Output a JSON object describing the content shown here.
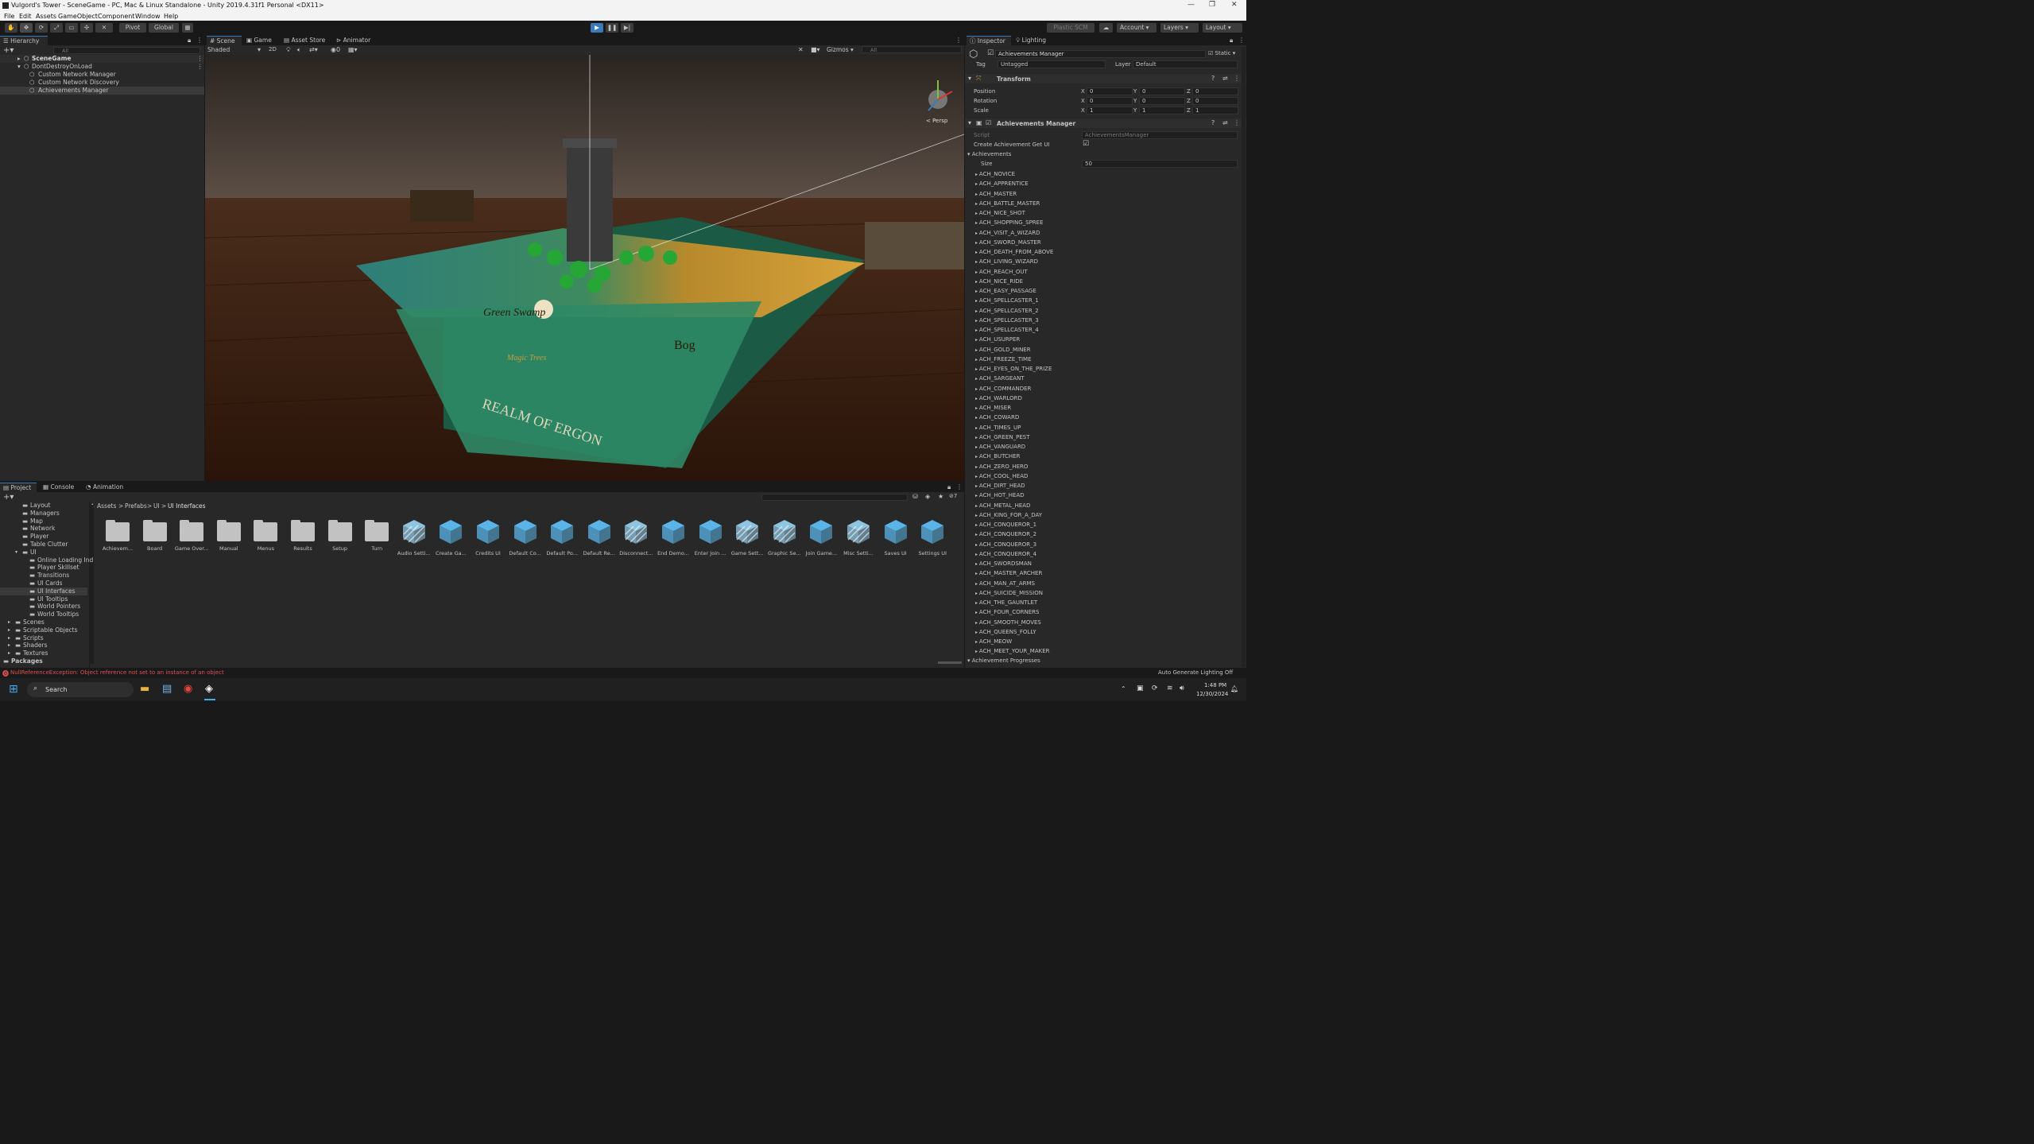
{
  "window": {
    "title": "Vulgord's Tower - SceneGame - PC, Mac & Linux Standalone - Unity 2019.4.31f1 Personal <DX11>"
  },
  "menu": [
    "File",
    "Edit",
    "Assets",
    "GameObject",
    "Component",
    "Window",
    "Help"
  ],
  "toolbar": {
    "pivot": "Pivot",
    "global": "Global",
    "plastic": "Plastic SCM",
    "account": "Account",
    "layers": "Layers",
    "layout": "Layout"
  },
  "hierarchy": {
    "tab": "Hierarchy",
    "search_placeholder": "All",
    "items": [
      {
        "label": "SceneGame"
      },
      {
        "label": "DontDestroyOnLoad"
      },
      {
        "label": "Custom Network Manager"
      },
      {
        "label": "Custom Network Discovery"
      },
      {
        "label": "Achievements Manager"
      }
    ]
  },
  "scene": {
    "tabs": [
      "Scene",
      "Game",
      "Asset Store",
      "Animator"
    ],
    "shading": "Shaded",
    "mode_2d": "2D",
    "gizmos": "Gizmos",
    "search_placeholder": "All",
    "persp": "< Persp",
    "board_labels": [
      "Green Swamp",
      "Magic Trees",
      "Bog",
      "REALM OF ERGON"
    ]
  },
  "inspector": {
    "tabs": [
      "Inspector",
      "Lighting"
    ],
    "object_name": "Achievements Manager",
    "static_label": "Static",
    "tag_label": "Tag",
    "tag_value": "Untagged",
    "layer_label": "Layer",
    "layer_value": "Default",
    "transform": {
      "title": "Transform",
      "rows": [
        {
          "label": "Position",
          "x": "0",
          "y": "0",
          "z": "0"
        },
        {
          "label": "Rotation",
          "x": "0",
          "y": "0",
          "z": "0"
        },
        {
          "label": "Scale",
          "x": "1",
          "y": "1",
          "z": "1"
        }
      ]
    },
    "component": {
      "title": "Achievements Manager",
      "script_label": "Script",
      "script_value": "AchievementsManager",
      "create_label": "Create Achievement Get UI",
      "achievements_label": "Achievements",
      "size_label": "Size",
      "size_value": "50",
      "progress_label": "Achievement Progresses"
    },
    "achievements": [
      "ACH_NOVICE",
      "ACH_APPRENTICE",
      "ACH_MASTER",
      "ACH_BATTLE_MASTER",
      "ACH_NICE_SHOT",
      "ACH_SHOPPING_SPREE",
      "ACH_VISIT_A_WIZARD",
      "ACH_SWORD_MASTER",
      "ACH_DEATH_FROM_ABOVE",
      "ACH_LIVING_WIZARD",
      "ACH_REACH_OUT",
      "ACH_NICE_RIDE",
      "ACH_EASY_PASSAGE",
      "ACH_SPELLCASTER_1",
      "ACH_SPELLCASTER_2",
      "ACH_SPELLCASTER_3",
      "ACH_SPELLCASTER_4",
      "ACH_USURPER",
      "ACH_GOLD_MINER",
      "ACH_FREEZE_TIME",
      "ACH_EYES_ON_THE_PRIZE",
      "ACH_SARGEANT",
      "ACH_COMMANDER",
      "ACH_WARLORD",
      "ACH_MISER",
      "ACH_COWARD",
      "ACH_TIMES_UP",
      "ACH_GREEN_PEST",
      "ACH_VANGUARD",
      "ACH_BUTCHER",
      "ACH_ZERO_HERO",
      "ACH_COOL_HEAD",
      "ACH_DIRT_HEAD",
      "ACH_HOT_HEAD",
      "ACH_METAL_HEAD",
      "ACH_KING_FOR_A_DAY",
      "ACH_CONQUEROR_1",
      "ACH_CONQUEROR_2",
      "ACH_CONQUEROR_3",
      "ACH_CONQUEROR_4",
      "ACH_SWORDSMAN",
      "ACH_MASTER_ARCHER",
      "ACH_MAN_AT_ARMS",
      "ACH_SUICIDE_MISSION",
      "ACH_THE_GAUNTLET",
      "ACH_FOUR_CORNERS",
      "ACH_SMOOTH_MOVES",
      "ACH_QUEENS_FOLLY",
      "ACH_MEOW",
      "ACH_MEET_YOUR_MAKER"
    ]
  },
  "project": {
    "tabs": [
      "Project",
      "Console",
      "Animation"
    ],
    "badge": "7",
    "breadcrumb": [
      "Assets",
      "Prefabs",
      "UI",
      "UI Interfaces"
    ],
    "tree": [
      {
        "label": "Layout",
        "indent": 1
      },
      {
        "label": "Managers",
        "indent": 1
      },
      {
        "label": "Map",
        "indent": 1
      },
      {
        "label": "Network",
        "indent": 1
      },
      {
        "label": "Player",
        "indent": 1
      },
      {
        "label": "Table Clutter",
        "indent": 1
      },
      {
        "label": "UI",
        "indent": 1
      },
      {
        "label": "Online Loading Ind",
        "indent": 2
      },
      {
        "label": "Player Skillset",
        "indent": 2
      },
      {
        "label": "Transitions",
        "indent": 2
      },
      {
        "label": "UI Cards",
        "indent": 2
      },
      {
        "label": "UI Interfaces",
        "indent": 2
      },
      {
        "label": "UI Tooltips",
        "indent": 2
      },
      {
        "label": "World Pointers",
        "indent": 2
      },
      {
        "label": "World Tooltips",
        "indent": 2
      },
      {
        "label": "Scenes",
        "indent": 0
      },
      {
        "label": "Scriptable Objects",
        "indent": 0
      },
      {
        "label": "Scripts",
        "indent": 0
      },
      {
        "label": "Shaders",
        "indent": 0
      },
      {
        "label": "Textures",
        "indent": 0
      },
      {
        "label": "Packages",
        "indent": -1
      }
    ],
    "assets": [
      {
        "label": "Achievem...",
        "kind": "folder"
      },
      {
        "label": "Board",
        "kind": "folder"
      },
      {
        "label": "Game Over...",
        "kind": "folder"
      },
      {
        "label": "Manual",
        "kind": "folder"
      },
      {
        "label": "Menus",
        "kind": "folder"
      },
      {
        "label": "Results",
        "kind": "folder"
      },
      {
        "label": "Setup",
        "kind": "folder"
      },
      {
        "label": "Turn",
        "kind": "folder"
      },
      {
        "label": "Audio Setti...",
        "kind": "variant"
      },
      {
        "label": "Create Ga...",
        "kind": "prefab"
      },
      {
        "label": "Credits UI",
        "kind": "prefab"
      },
      {
        "label": "Default Co...",
        "kind": "prefab"
      },
      {
        "label": "Default Po...",
        "kind": "prefab"
      },
      {
        "label": "Default Re...",
        "kind": "prefab"
      },
      {
        "label": "Disconnect...",
        "kind": "variant"
      },
      {
        "label": "End Demo...",
        "kind": "prefab"
      },
      {
        "label": "Enter Join ...",
        "kind": "prefab"
      },
      {
        "label": "Game Sett...",
        "kind": "variant"
      },
      {
        "label": "Graphic Se...",
        "kind": "variant"
      },
      {
        "label": "Join Game...",
        "kind": "prefab"
      },
      {
        "label": "Misc Setti...",
        "kind": "variant"
      },
      {
        "label": "Saves UI",
        "kind": "prefab"
      },
      {
        "label": "Settings UI",
        "kind": "prefab"
      }
    ]
  },
  "status": {
    "error": "NullReferenceException: Object reference not set to an instance of an object",
    "lighting": "Auto Generate Lighting Off"
  },
  "taskbar": {
    "search": "Search",
    "time": "1:48 PM",
    "date": "12/30/2024"
  },
  "colors": {
    "accent": "#3a79bb",
    "error": "#e05252",
    "prefab": "#5ab4e8"
  }
}
